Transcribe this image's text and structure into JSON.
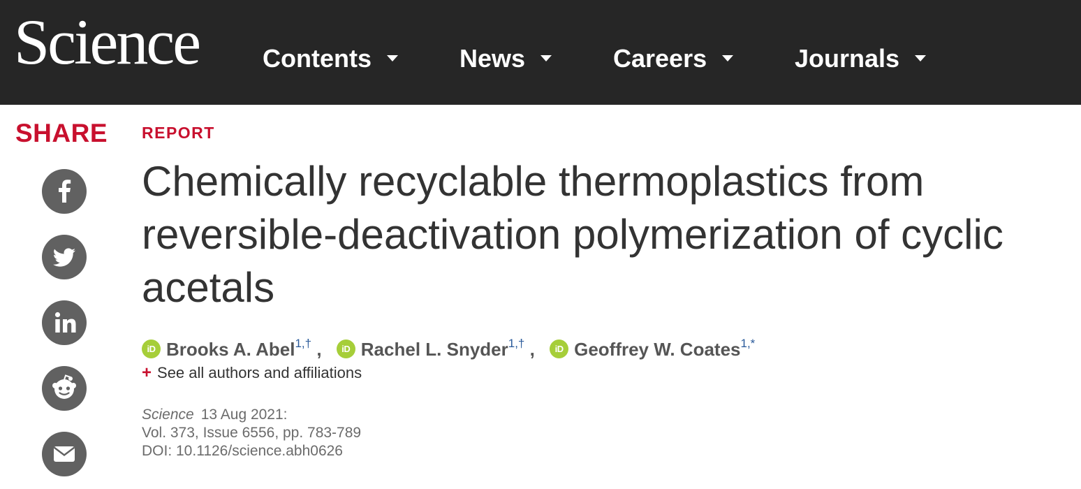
{
  "header": {
    "logo": "Science",
    "nav": [
      {
        "label": "Contents"
      },
      {
        "label": "News"
      },
      {
        "label": "Careers"
      },
      {
        "label": "Journals"
      }
    ],
    "background": "#262626"
  },
  "share": {
    "label": "SHARE",
    "buttons": [
      {
        "icon": "facebook-icon"
      },
      {
        "icon": "twitter-icon"
      },
      {
        "icon": "linkedin-icon"
      },
      {
        "icon": "reddit-icon"
      },
      {
        "icon": "email-icon"
      }
    ]
  },
  "article": {
    "type": "REPORT",
    "title": "Chemically recyclable thermoplastics from reversible-deactivation polymerization of cyclic acetals",
    "authors": [
      {
        "name": "Brooks A. Abel",
        "affil": "1,†"
      },
      {
        "name": "Rachel L. Snyder",
        "affil": "1,†"
      },
      {
        "name": "Geoffrey W. Coates",
        "affil": "1,*"
      }
    ],
    "orcid_badge": "iD",
    "see_all": "See all authors and affiliations",
    "citation": {
      "journal": "Science",
      "date": "13 Aug 2021:",
      "volume_line": "Vol. 373, Issue 6556, pp. 783-789",
      "doi_line": "DOI: 10.1126/science.abh0626"
    }
  },
  "colors": {
    "accent_red": "#c8102e",
    "orcid_green": "#a6ce39",
    "share_gray": "#616161",
    "affil_blue": "#2a5a9a"
  }
}
